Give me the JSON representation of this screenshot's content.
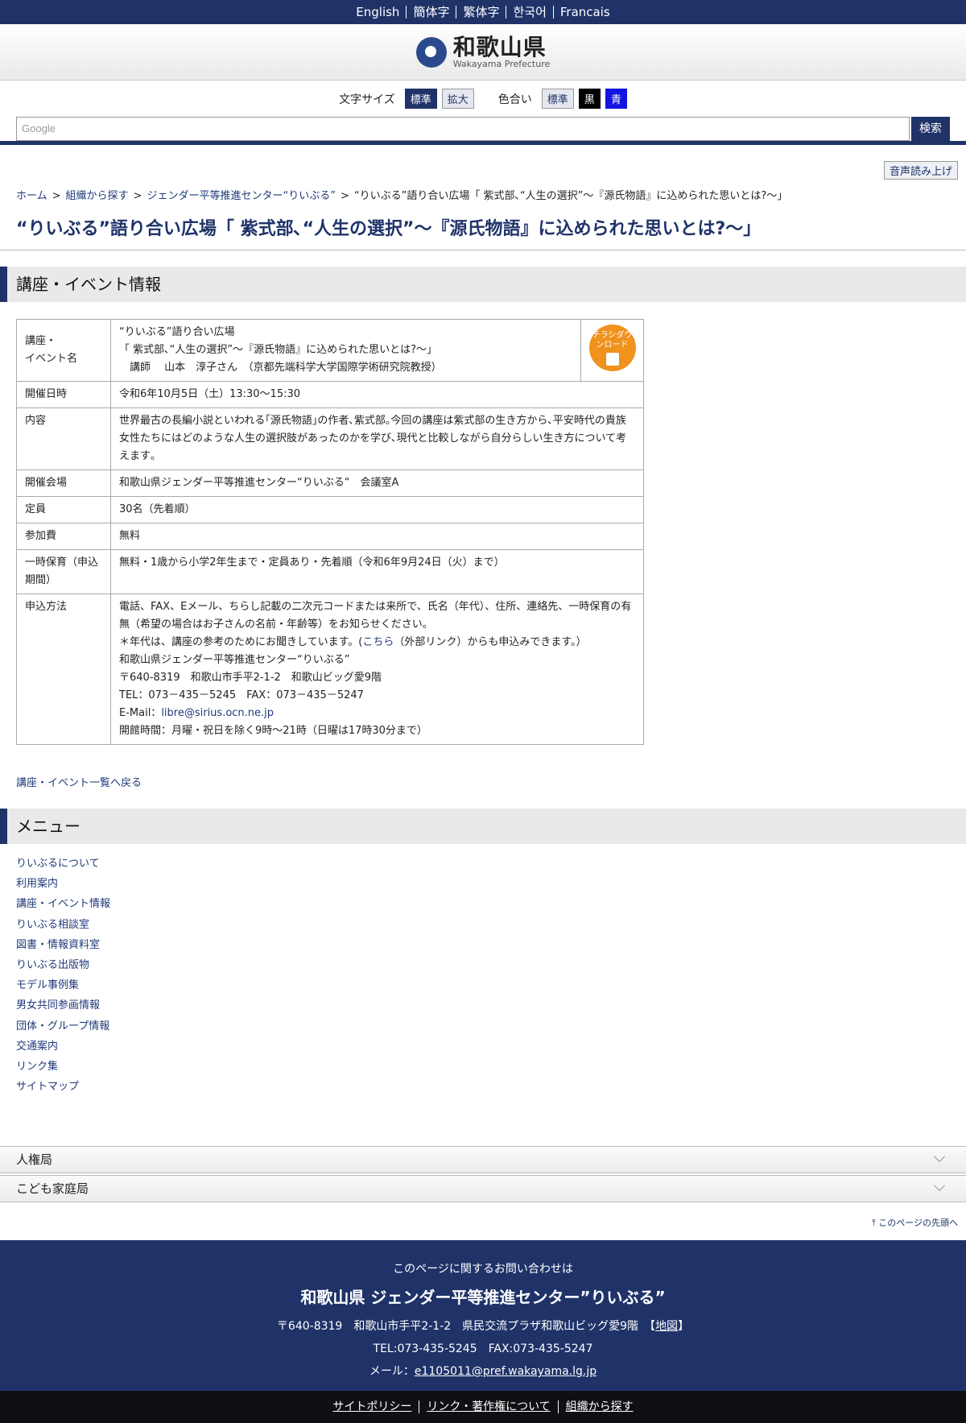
{
  "lang": [
    "English",
    "簡体字",
    "繁体字",
    "한국어",
    "Francais"
  ],
  "header": {
    "logo_ja": "和歌山県",
    "logo_en": "Wakayama Prefecture"
  },
  "tools": {
    "size_label": "文字サイズ",
    "size_std": "標準",
    "size_big": "拡大",
    "color_label": "色合い",
    "color_std": "標準",
    "color_black": "黒",
    "color_blue": "青"
  },
  "search": {
    "placeholder": "Google",
    "button": "検索"
  },
  "voice": "音声読み上げ",
  "breadcrumb": {
    "home": "ホーム",
    "org": "組織から探す",
    "center": "ジェンダー平等推進センター“りいぶる”",
    "current": "“りいぶる”語り合い広場「 紫式部､“人生の選択”～『源氏物語』に込められた思いとは?～」"
  },
  "page_title": "“りいぶる”語り合い広場「 紫式部､“人生の選択”～『源氏物語』に込められた思いとは?～」",
  "section_event": "講座・イベント情報",
  "event": {
    "name_label": "講座・\nイベント名",
    "name_line1": "“りいぶる”語り合い広場",
    "name_line2": "「 紫式部､“人生の選択”～『源氏物語』に込められた思いとは?～」",
    "name_line3": "　講師　 山本　淳子さん　（京都先端科学大学国際学術研究院教授）",
    "flyer": "チラシダウンロード",
    "date_label": "開催日時",
    "date": "令和6年10月5日（土）13:30～15:30",
    "content_label": "内容",
    "content": "世界最古の長編小説といわれる｢源氏物語｣の作者､紫式部｡今回の講座は紫式部の生き方から､平安時代の貴族女性たちにはどのような人生の選択肢があったのかを学び､現代と比較しながら自分らしい生き方について考えます｡",
    "venue_label": "開催会場",
    "venue": "和歌山県ジェンダー平等推進センター“りいぶる“　会議室A",
    "capacity_label": "定員",
    "capacity": "30名（先着順）",
    "fee_label": "参加費",
    "fee": "無料",
    "childcare_label": "一時保育（申込期間）",
    "childcare": "無料・1歳から小学2年生まで・定員あり・先着順（令和6年9月24日（火）まで）",
    "apply_label": "申込方法",
    "apply_1": "電話、FAX、Eメール、ちらし記載の二次元コードまたは来所で、氏名（年代）、住所、連絡先、一時保育の有無（希望の場合はお子さんの名前・年齢等）をお知らせください。",
    "apply_2a": "＊年代は、講座の参考のためにお聞きしています。(",
    "apply_2link": "こちら",
    "apply_2b": "（外部リンク）からも申込みできます。）",
    "apply_3": "和歌山県ジェンダー平等推進センター“りいぶる”",
    "apply_4": "〒640-8319　和歌山市手平2-1-2　和歌山ビッグ愛9階",
    "apply_5": "TEL：073－435－5245　FAX：073－435－5247",
    "apply_6a": "E-Mail：",
    "apply_6link": "libre@sirius.ocn.ne.jp",
    "apply_7": "開館時間：月曜・祝日を除く9時～21時（日曜は17時30分まで）"
  },
  "back_link": "講座・イベント一覧へ戻る",
  "section_menu": "メニュー",
  "menu": [
    "りいぶるについて",
    "利用案内",
    "講座・イベント情報",
    "りいぶる相談室",
    "図書・情報資料室",
    "りいぶる出版物",
    "モデル事例集",
    "男女共同参画情報",
    "団体・グループ情報",
    "交通案内",
    "リンク集",
    "サイトマップ"
  ],
  "accordion": [
    "人権局",
    "こども家庭局"
  ],
  "pagetop": "このページの先頭へ",
  "footer": {
    "inquiry": "このページに関するお問い合わせは",
    "org": "和歌山県 ジェンダー平等推進センター”りいぶる”",
    "address": "〒640-8319　和歌山市手平2-1-2　県民交流プラザ和歌山ビッグ愛9階　【",
    "map": "地図",
    "address_end": "】",
    "tel": "TEL:073-435-5245　FAX:073-435-5247",
    "mail_label": "メール：",
    "mail": "e1105011@pref.wakayama.lg.jp"
  },
  "bottom_links": [
    "サイトポリシー",
    "リンク・著作権について",
    "組織から探す"
  ]
}
